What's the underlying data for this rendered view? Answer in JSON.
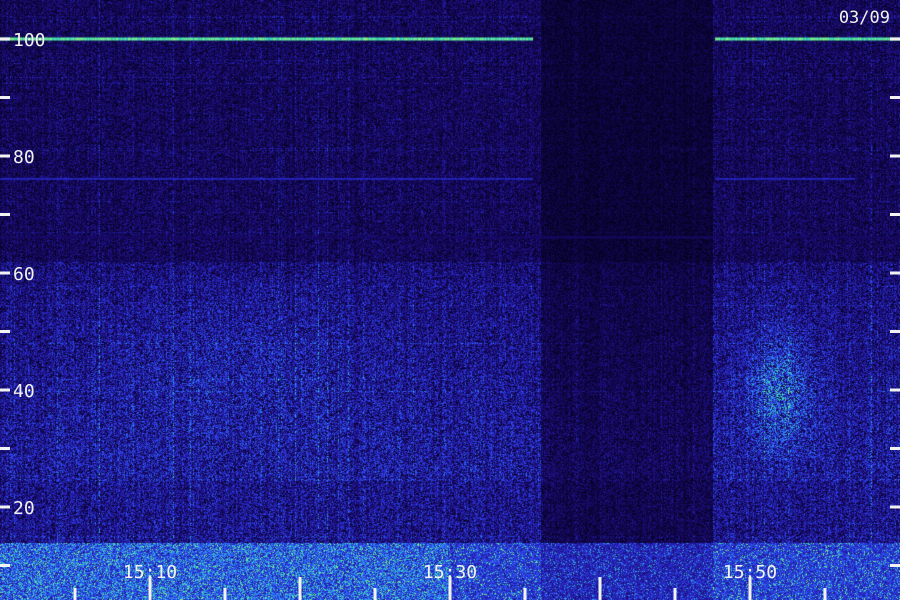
{
  "chart_data": {
    "type": "heatmap",
    "date_label": "03/09",
    "x_range_minutes": [
      0,
      60
    ],
    "x_tick_every_minutes": 5,
    "x_tick_labels": [
      {
        "minute": 10,
        "label": "15:10"
      },
      {
        "minute": 30,
        "label": "15:30"
      },
      {
        "minute": 50,
        "label": "15:50"
      }
    ],
    "y_range": [
      0,
      102
    ],
    "y_tick_every": 10,
    "y_tick_labels": [
      {
        "value": 100,
        "label": "100"
      },
      {
        "value": 80,
        "label": "80"
      },
      {
        "value": 60,
        "label": "60"
      },
      {
        "value": 40,
        "label": "40"
      },
      {
        "value": 20,
        "label": "20"
      }
    ],
    "signals": [
      {
        "y": 100,
        "x_segments": [
          [
            0,
            35.5
          ],
          [
            47.7,
            60
          ]
        ],
        "level": 1.0
      },
      {
        "y": 76,
        "x_segments": [
          [
            0,
            35.5
          ],
          [
            47.7,
            57
          ]
        ],
        "level": 0.55
      },
      {
        "y": 66,
        "x_segments": [
          [
            0,
            60
          ]
        ],
        "level": 0.25
      },
      {
        "y": 92,
        "x_segments": [
          [
            12,
            30
          ]
        ],
        "level": 0.2
      }
    ],
    "gap_minutes": [
      36,
      47.5
    ],
    "colormap": [
      "#000010",
      "#1a0a6e",
      "#2b2fd8",
      "#2e79ff",
      "#39e0b0",
      "#b6ff70"
    ]
  }
}
